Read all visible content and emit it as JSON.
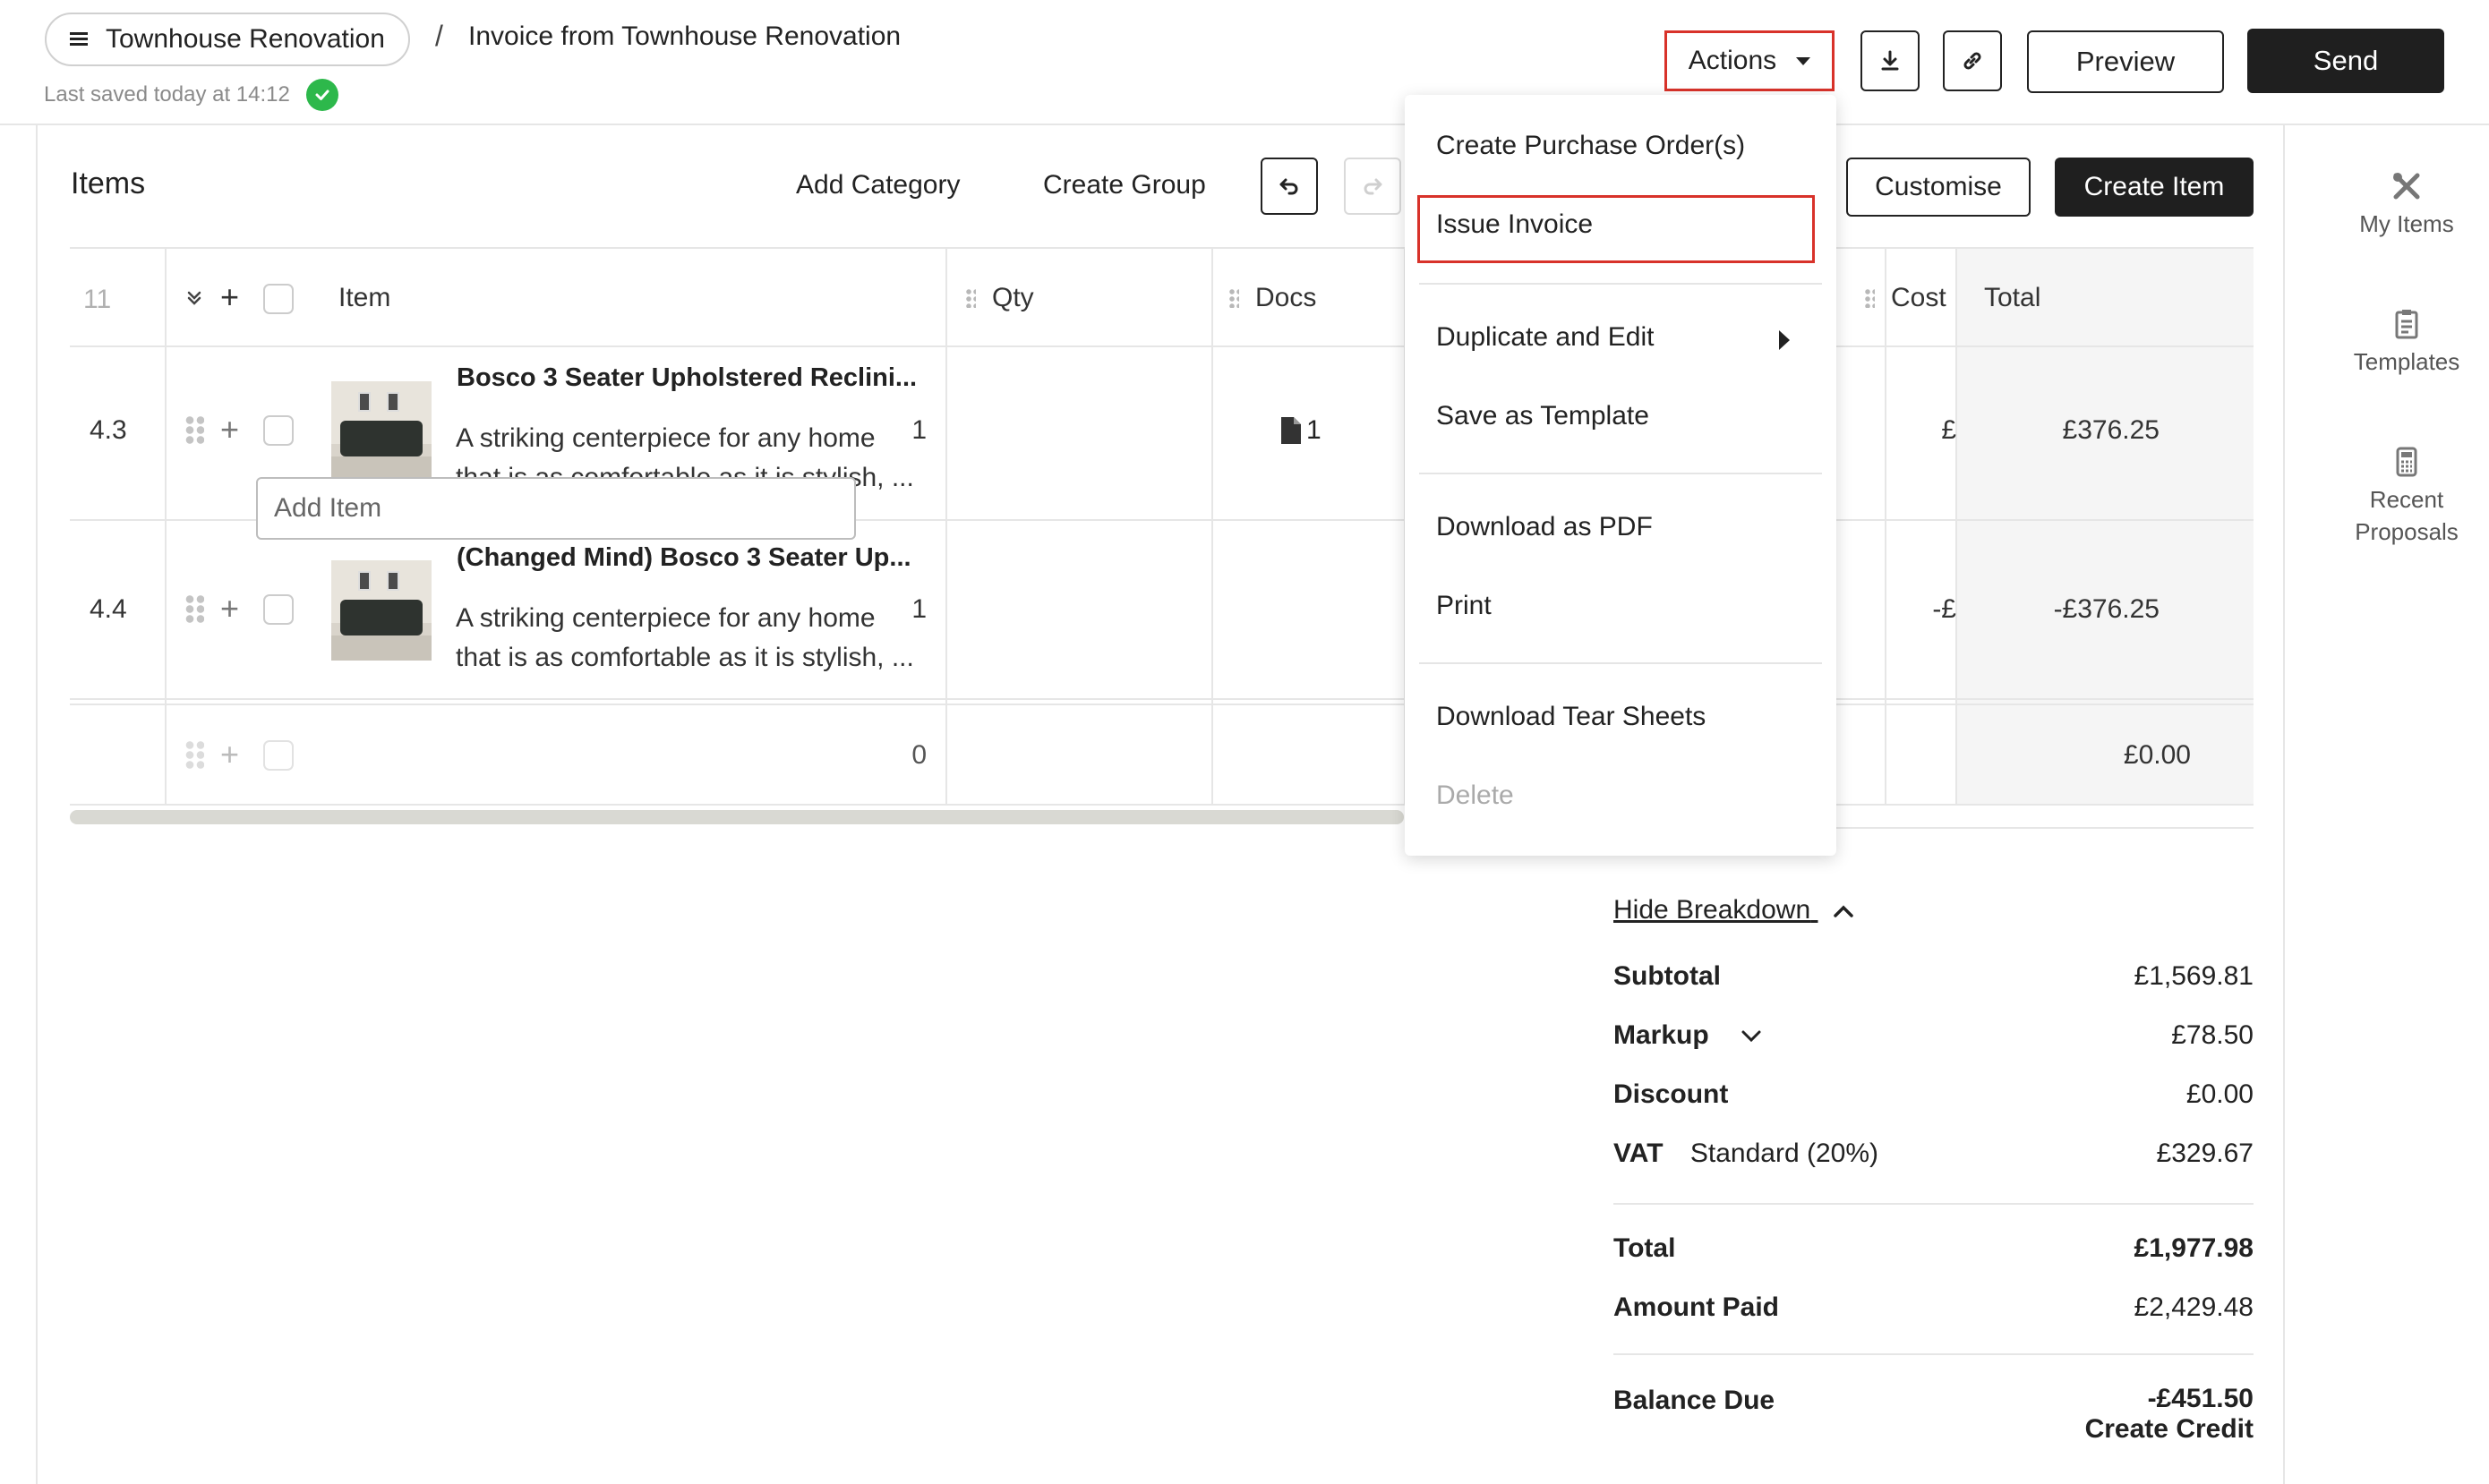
{
  "header": {
    "project": "Townhouse Renovation",
    "separator": "/",
    "title": "Invoice from Townhouse Renovation",
    "saved": "Last saved today at 14:12",
    "actions_label": "Actions",
    "preview_label": "Preview",
    "send_label": "Send"
  },
  "toolbar": {
    "items_title": "Items",
    "add_category": "Add Category",
    "create_group": "Create Group",
    "customise": "Customise",
    "create_item": "Create Item"
  },
  "table": {
    "header_num": "11",
    "columns": {
      "item": "Item",
      "qty": "Qty",
      "docs": "Docs",
      "cost": "Cost",
      "total": "Total"
    },
    "rows": [
      {
        "num": "4.3",
        "name": "Bosco 3 Seater Upholstered Reclini...",
        "desc1": "A striking centerpiece for any home",
        "desc2": "that is as comfortable as it is stylish, ...",
        "qty": "1",
        "docs": "1",
        "cost": "£",
        "total": "£376.25"
      },
      {
        "num": "4.4",
        "name": "(Changed Mind) Bosco 3 Seater Up...",
        "desc1": "A striking centerpiece for any home",
        "desc2": "that is as comfortable as it is stylish, ...",
        "qty": "1",
        "docs": "",
        "cost": "-£",
        "total": "-£376.25"
      }
    ],
    "add_row": {
      "placeholder": "Add Item",
      "qty": "0",
      "total": "£0.00"
    }
  },
  "dropdown": {
    "items": [
      "Create Purchase Order(s)",
      "Issue Invoice",
      "Duplicate and Edit",
      "Save as Template",
      "Download as PDF",
      "Print",
      "Download Tear Sheets",
      "Delete"
    ]
  },
  "summary": {
    "hide_breakdown": "Hide Breakdown",
    "subtotal_label": "Subtotal",
    "subtotal": "£1,569.81",
    "markup_label": "Markup",
    "markup": "£78.50",
    "discount_label": "Discount",
    "discount": "£0.00",
    "vat_label": "VAT",
    "vat_rate": "Standard (20%)",
    "vat": "£329.67",
    "total_label": "Total",
    "total": "£1,977.98",
    "paid_label": "Amount Paid",
    "paid": "£2,429.48",
    "balance_label": "Balance Due",
    "balance": "-£451.50",
    "create_credit": "Create Credit"
  },
  "sidebar": {
    "my_items": "My Items",
    "templates": "Templates",
    "recent1": "Recent",
    "recent2": "Proposals"
  },
  "colors": {
    "highlight": "#d8322a",
    "check": "#2db84b",
    "dark_button": "#1f1f1f"
  }
}
